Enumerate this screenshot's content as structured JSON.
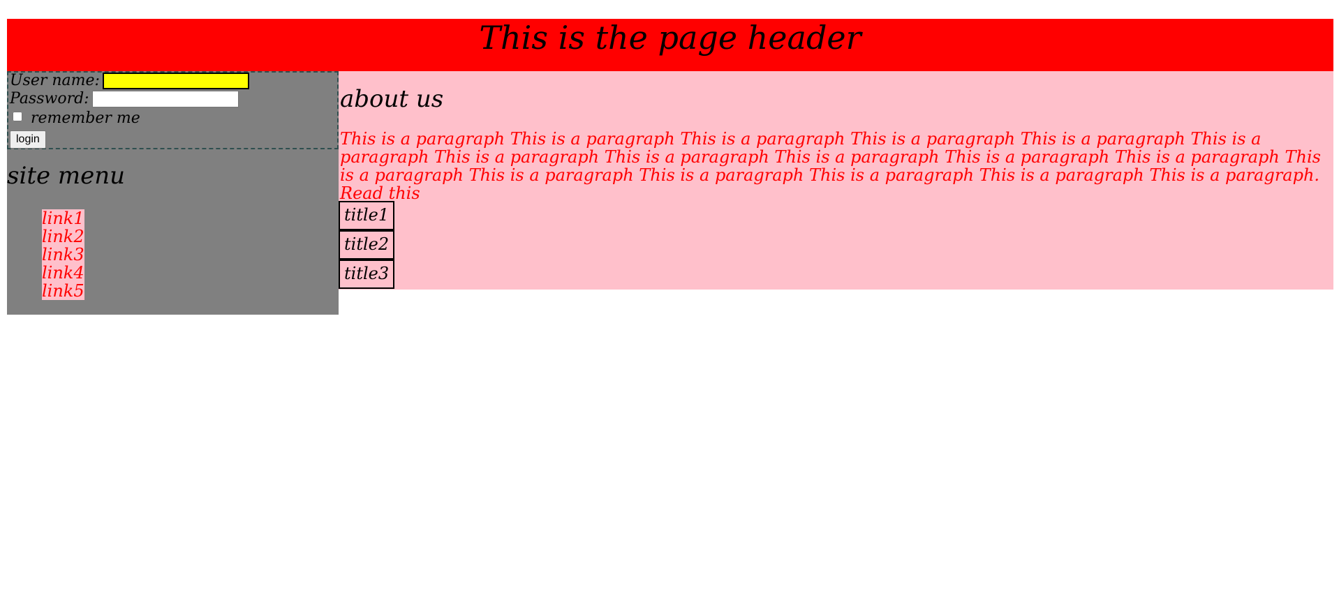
{
  "header": {
    "title": "This is the page header"
  },
  "login": {
    "username_label": "User name:",
    "username_value": "",
    "password_label": "Password:",
    "password_value": "",
    "remember_label": "remember me",
    "remember_checked": false,
    "submit_label": "login"
  },
  "sidebar": {
    "title": "site menu",
    "links": [
      {
        "label": "link1"
      },
      {
        "label": "link2"
      },
      {
        "label": "link3"
      },
      {
        "label": "link4"
      },
      {
        "label": "link5"
      }
    ]
  },
  "content": {
    "title": "about us",
    "paragraph": "This is a paragraph This is a paragraph This is a paragraph This is a paragraph This is a paragraph This is a paragraph This is a paragraph This is a paragraph This is a paragraph This is a paragraph This is a paragraph This is a paragraph This is a paragraph This is a paragraph This is a paragraph This is a paragraph This is a paragraph. Read this",
    "titles": [
      {
        "label": "title1"
      },
      {
        "label": "title2"
      },
      {
        "label": "title3"
      }
    ]
  },
  "colors": {
    "header_bg": "#ff0000",
    "sidebar_bg": "#808080",
    "content_bg": "#ffc0cb",
    "link_text": "#ff0000",
    "username_field_bg": "#ffff00"
  }
}
